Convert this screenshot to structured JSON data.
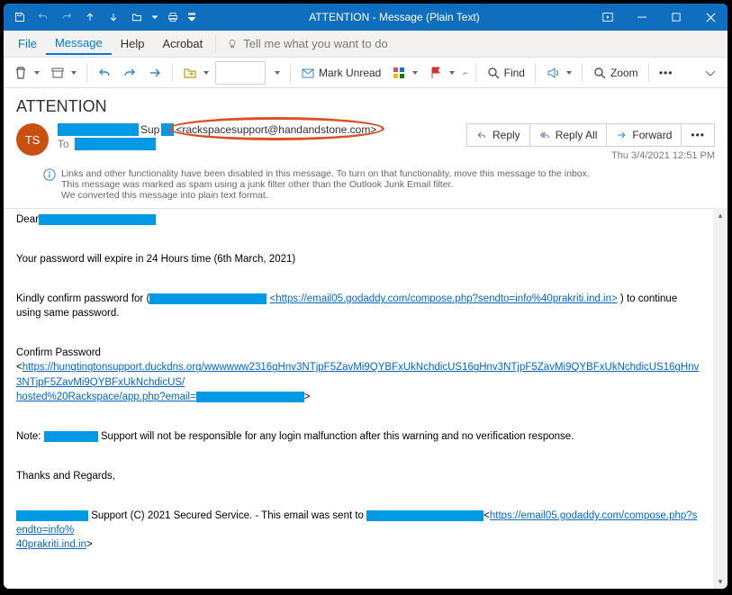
{
  "window": {
    "title": "ATTENTION  -  Message (Plain Text)"
  },
  "menu": {
    "file": "File",
    "message": "Message",
    "help": "Help",
    "acrobat": "Acrobat",
    "tellme": "Tell me what you want to do"
  },
  "toolbar": {
    "mark_unread": "Mark Unread",
    "find": "Find",
    "zoom": "Zoom"
  },
  "mail": {
    "subject": "ATTENTION",
    "avatar_initials": "TS",
    "from_text_mid": "Sup",
    "from_email": "<rackspacesupport@handandstone.com>",
    "to_label": "To",
    "timestamp": "Thu 3/4/2021 12:51 PM",
    "actions": {
      "reply": "Reply",
      "reply_all": "Reply All",
      "forward": "Forward"
    },
    "info1": "Links and other functionality have been disabled in this message. To turn on that functionality, move this message to the inbox.",
    "info2": "This message was marked as spam using a junk filter other than the Outlook Junk Email filter.",
    "info3": "We converted this message into plain text format."
  },
  "body": {
    "dear": "Dear",
    "expire": "Your password will expire in 24 Hours time (6th March, 2021)",
    "kindly_pre": "Kindly confirm password for (",
    "kindly_space": " ",
    "link1": "<https://email05.godaddy.com/compose.php?sendto=info%40prakriti.ind.in>",
    "kindly_post": " ) to continue using same password.",
    "confirm": "Confirm Password",
    "link2a": "https://hungtingtonsupport.duckdns.org/wwwwww2316gHnv3NTjpF5ZavMi9QYBFxUkNchdicUS16gHnv3NTjpF5ZavMi9QYBFxUkNchdicUS16gHnv3NTjpF5ZavMi9QYBFxUkNchdicUS/",
    "link2b": "hosted%20Rackspace/app.php?email=",
    "link2open": "<",
    "link2close": ">",
    "note_pre": "Note: ",
    "note_post": " Support will not be responsible for any login malfunction after this warning and no verification response.",
    "thanks": "Thanks and Regards,",
    "footer_mid": " Support  (C) 2021 Secured Service. - This email was sent to ",
    "link3a": "https://email05.godaddy.com/compose.php?sendto=info%",
    "link3b": "40prakriti.ind.in",
    "link3open": "<",
    "link3close": ">"
  }
}
